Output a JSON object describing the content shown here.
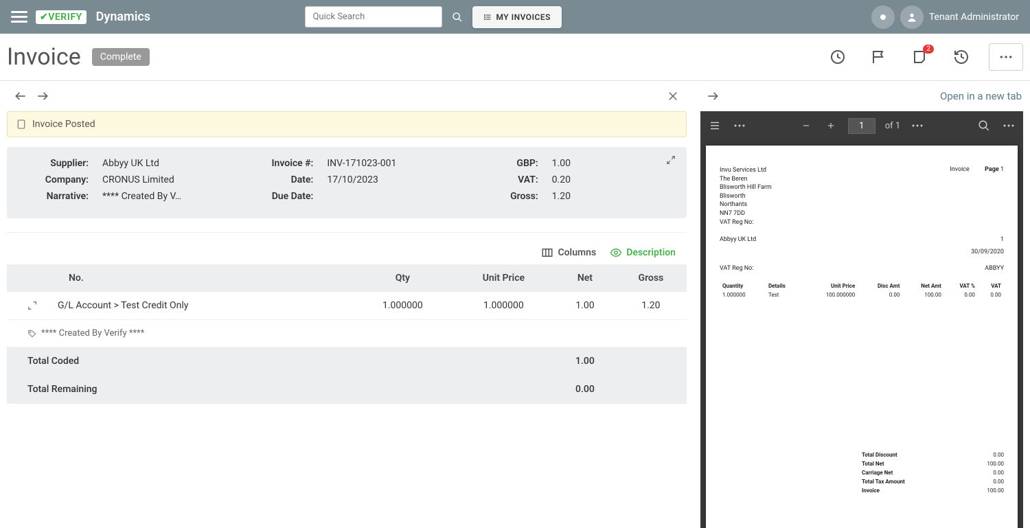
{
  "topbar": {
    "brand": "Dynamics",
    "logo_text": "VERIFY",
    "search_placeholder": "Quick Search",
    "my_invoices": "MY INVOICES",
    "user": "Tenant Administrator"
  },
  "page": {
    "title": "Invoice",
    "status": "Complete",
    "notes_badge": "2"
  },
  "banner": {
    "text": "Invoice Posted"
  },
  "info": {
    "supplier_lbl": "Supplier:",
    "supplier": "Abbyy UK Ltd",
    "company_lbl": "Company:",
    "company": "CRONUS Limited",
    "narrative_lbl": "Narrative:",
    "narrative": "**** Created By V…",
    "invoice_no_lbl": "Invoice #:",
    "invoice_no": "INV-171023-001",
    "date_lbl": "Date:",
    "date": "17/10/2023",
    "due_date_lbl": "Due Date:",
    "due_date": "",
    "gbp_lbl": "GBP:",
    "gbp": "1.00",
    "vat_lbl": "VAT:",
    "vat": "0.20",
    "gross_lbl": "Gross:",
    "gross": "1.20"
  },
  "controls": {
    "columns": "Columns",
    "description": "Description"
  },
  "table": {
    "headers": {
      "no": "No.",
      "qty": "Qty",
      "unit_price": "Unit Price",
      "net": "Net",
      "gross": "Gross"
    },
    "row": {
      "no": "G/L Account > Test Credit Only",
      "qty": "1.000000",
      "unit_price": "1.000000",
      "net": "1.00",
      "gross": "1.20"
    },
    "desc": "**** Created By Verify ****",
    "total_coded_lbl": "Total Coded",
    "total_coded": "1.00",
    "total_remaining_lbl": "Total Remaining",
    "total_remaining": "0.00"
  },
  "right": {
    "open_tab": "Open in a new tab"
  },
  "viewer": {
    "page": "1",
    "of": "of 1"
  },
  "doc": {
    "addr": [
      "Invu Services Ltd",
      "The Beren",
      "Blisworth Hill Farm",
      "Blisworth",
      "Northants",
      "NN7 7DD",
      "VAT Reg No:"
    ],
    "title": "Invoice",
    "page_lbl": "Page",
    "page_no": "1",
    "supplier": "Abbyy UK Ltd",
    "supplier_no": "1",
    "doc_date": "30/09/2020",
    "vat_reg_lbl": "VAT Reg No:",
    "vat_reg": "ABBYY",
    "cols": {
      "qty": "Quantity",
      "details": "Details",
      "unit_price": "Unit Price",
      "disc_amt": "Disc Amt",
      "net_amt": "Net Amt",
      "vat_pct": "VAT %",
      "vat": "VAT"
    },
    "line": {
      "qty": "1.000000",
      "details": "Test",
      "unit_price": "100.000000",
      "disc_amt": "0.00",
      "net_amt": "100.00",
      "vat_pct": "0.00",
      "vat": "0.00"
    },
    "totals": [
      {
        "lbl": "Total Discount",
        "val": "0.00"
      },
      {
        "lbl": "Total Net",
        "val": "100.00"
      },
      {
        "lbl": "Carriage Net",
        "val": "0.00"
      },
      {
        "lbl": "Total Tax Amount",
        "val": "0.00"
      },
      {
        "lbl": "Invoice",
        "val": "100.00"
      }
    ]
  }
}
